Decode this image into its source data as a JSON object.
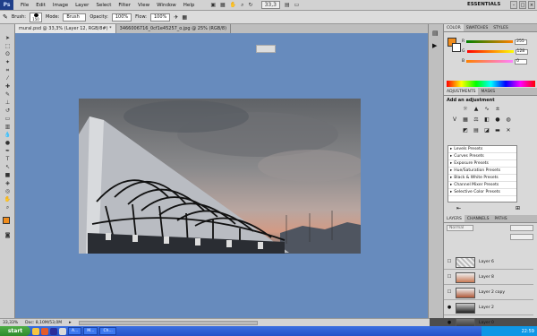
{
  "menubar": {
    "logo": "Ps",
    "items": [
      "File",
      "Edit",
      "Image",
      "Layer",
      "Select",
      "Filter",
      "View",
      "Window",
      "Help"
    ],
    "zoom": "33,3",
    "workspace": "ESSENTIALS",
    "controls": [
      "–",
      "□",
      "×"
    ]
  },
  "options": {
    "brush_label": "Brush:",
    "brush_size": "150",
    "mode_label": "Mode:",
    "mode_value": "Brush",
    "opacity_label": "Opacity:",
    "opacity_value": "100%",
    "flow_label": "Flow:",
    "flow_value": "100%"
  },
  "tabs": [
    {
      "label": "mural.psd @ 33,3% (Layer 12, RGB/8#) *",
      "active": true
    },
    {
      "label": "3466006716_0cf1e45257_o.jpg @ 25% (RGB/8)",
      "active": false
    }
  ],
  "status": {
    "zoom": "33,33%",
    "doc": "Doc: 8,10M/53,0M"
  },
  "color_panel": {
    "tabs": [
      "COLOR",
      "SWATCHES",
      "STYLES"
    ],
    "channels": [
      {
        "name": "R",
        "value": "255"
      },
      {
        "name": "G",
        "value": "128"
      },
      {
        "name": "B",
        "value": "0"
      }
    ],
    "foreground": "#f08c1c",
    "background": "#ffffff"
  },
  "adjustments": {
    "tabs": [
      "ADJUSTMENTS",
      "MASKS"
    ],
    "title": "Add an adjustment",
    "presets": [
      "Levels Presets",
      "Curves Presets",
      "Exposure Presets",
      "Hue/Saturation Presets",
      "Black & White Presets",
      "Channel Mixer Presets",
      "Selective Color Presets"
    ]
  },
  "layers": {
    "tabs": [
      "LAYERS",
      "CHANNELS",
      "PATHS"
    ],
    "blend_mode": "Normal",
    "items": [
      {
        "name": "Layer 6",
        "visible": false
      },
      {
        "name": "Layer 8",
        "visible": false
      },
      {
        "name": "Layer 2 copy",
        "visible": false
      },
      {
        "name": "Layer 2",
        "visible": true
      },
      {
        "name": "Layer 0",
        "visible": true
      }
    ]
  },
  "taskbar": {
    "start": "start",
    "buttons": [
      "A...",
      "M...",
      "Ch..."
    ],
    "time": "22:59"
  }
}
